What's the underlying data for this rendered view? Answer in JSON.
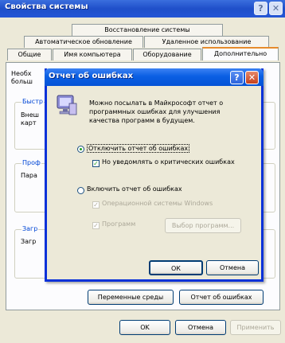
{
  "window": {
    "title": "Свойства системы",
    "help_glyph": "?",
    "close_glyph": "✕"
  },
  "tabs": {
    "row1": [
      "Восстановление системы"
    ],
    "row2": [
      "Автоматическое обновление",
      "Удаленное использование"
    ],
    "row3": [
      "Общие",
      "Имя компьютера",
      "Оборудование",
      "Дополнительно"
    ]
  },
  "panel": {
    "intro_text_1": "Необх",
    "intro_text_2": "больш",
    "group1_label": "Быстр",
    "group1_text_1": "Внеш",
    "group1_text_2": "карт",
    "group2_label": "Проф",
    "group2_text": "Пара",
    "group3_label": "Загр",
    "group3_text": "Загр"
  },
  "bottom_buttons": {
    "env_vars": "Переменные среды",
    "error_report": "Отчет об ошибках",
    "ok": "OK",
    "cancel": "Отмена",
    "apply": "Применить"
  },
  "dialog": {
    "title": "Отчет об ошибках",
    "help_glyph": "?",
    "close_glyph": "✕",
    "description": [
      "Можно посылать в Майкрософт отчет о",
      "программных ошибках для улучшения",
      "качества программ в будущем."
    ],
    "radio_disable_label": "Отключить отчет об ошибках",
    "radio_disable_selected": true,
    "check_no_notify_label": "Но уведомлять о критических ошибках",
    "check_no_notify_checked": true,
    "radio_enable_label": "Включить отчет об ошибках",
    "radio_enable_selected": false,
    "check_os_label": "Операционной системы Windows",
    "check_os_checked": true,
    "check_programs_label": "Программ",
    "check_programs_checked": true,
    "choose_programs_button": "Выбор программ...",
    "ok_button": "ОК",
    "cancel_button": "Отмена"
  }
}
